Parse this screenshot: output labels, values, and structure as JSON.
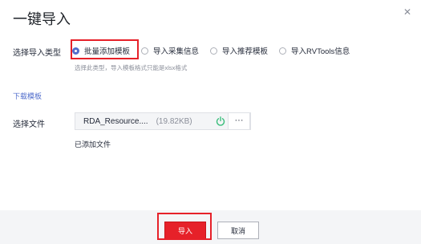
{
  "dialog": {
    "title": "一键导入",
    "close_icon": "close-icon"
  },
  "import_type": {
    "label": "选择导入类型",
    "options": [
      {
        "label": "批量添加模板",
        "checked": true
      },
      {
        "label": "导入采集信息",
        "checked": false
      },
      {
        "label": "导入推荐模板",
        "checked": false
      },
      {
        "label": "导入RVTools信息",
        "checked": false
      }
    ],
    "hint": "选择此类型，导入模板格式只能是xlsx格式"
  },
  "download_template": "下载模板",
  "file": {
    "label": "选择文件",
    "name": "RDA_Resource....",
    "size": "(19.82KB)",
    "status_icon": "power-loading-icon",
    "more_label": "···",
    "added_text": "已添加文件"
  },
  "footer": {
    "import_label": "导入",
    "cancel_label": "取消"
  },
  "colors": {
    "accent": "#526ecc",
    "primary_button": "#e62129",
    "highlight": "#e62129",
    "status_green": "#3fbf7f"
  }
}
